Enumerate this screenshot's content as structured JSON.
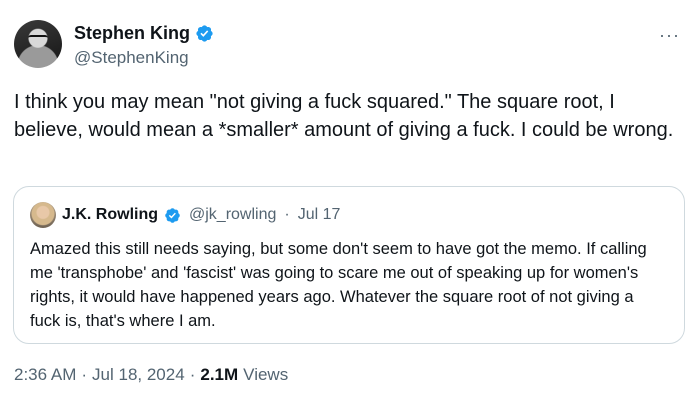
{
  "author": {
    "display_name": "Stephen King",
    "handle": "@StephenKing",
    "verified_icon": "verified-badge-icon"
  },
  "menu": {
    "more_icon": "more-horizontal-icon",
    "more_label": "···"
  },
  "tweet": {
    "text": "I think you may mean \"not giving a fuck squared.\" The square root, I believe, would mean a *smaller* amount of giving a fuck. I could be wrong."
  },
  "quote": {
    "display_name": "J.K. Rowling",
    "handle": "@jk_rowling",
    "separator": "·",
    "date": "Jul 17",
    "text": "Amazed this still needs saying, but some don't seem to have got the memo. If calling me 'transphobe' and 'fascist' was going to scare me out of speaking up for women's rights, it would have happened years ago. Whatever the square root of not giving a fuck is, that's where I am."
  },
  "footer": {
    "time": "2:36 AM",
    "separator1": "·",
    "date": "Jul 18, 2024",
    "separator2": "·",
    "views_count": "2.1M",
    "views_label": "Views"
  },
  "colors": {
    "text": "#0f1419",
    "secondary": "#536471",
    "verified": "#1d9bf0",
    "border": "#cfd9de"
  }
}
